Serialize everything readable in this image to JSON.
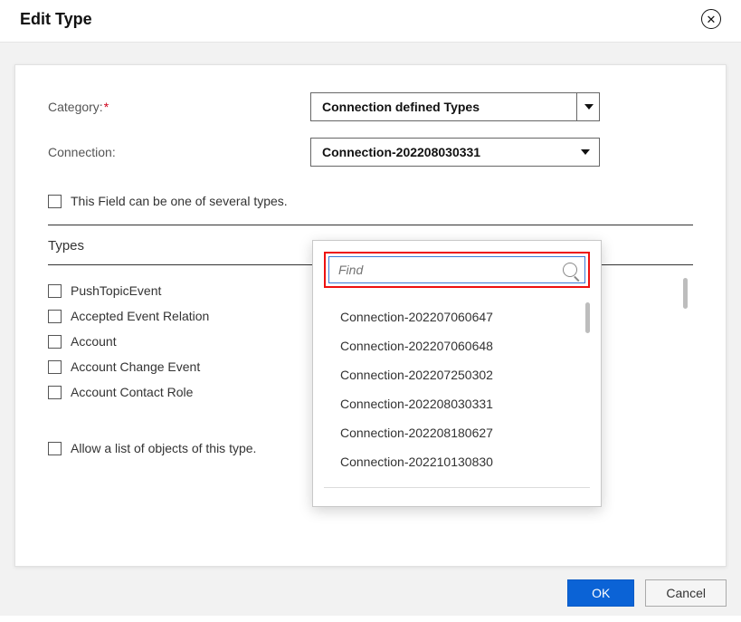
{
  "header": {
    "title": "Edit Type"
  },
  "form": {
    "category": {
      "label": "Category:",
      "required": "*",
      "value": "Connection defined Types"
    },
    "connection": {
      "label": "Connection:",
      "value": "Connection-202208030331"
    },
    "severalTypes": {
      "label": "This Field can be one of several types."
    },
    "typesHeading": "Types",
    "allowList": {
      "label": "Allow a list of objects of this type."
    }
  },
  "types": [
    "PushTopicEvent",
    "Accepted Event Relation",
    "Account",
    "Account Change Event",
    "Account Contact Role"
  ],
  "dropdown": {
    "searchPlaceholder": "Find",
    "options": [
      "Connection-202207060647",
      "Connection-202207060648",
      "Connection-202207250302",
      "Connection-202208030331",
      "Connection-202208180627",
      "Connection-202210130830"
    ]
  },
  "buttons": {
    "ok": "OK",
    "cancel": "Cancel"
  }
}
